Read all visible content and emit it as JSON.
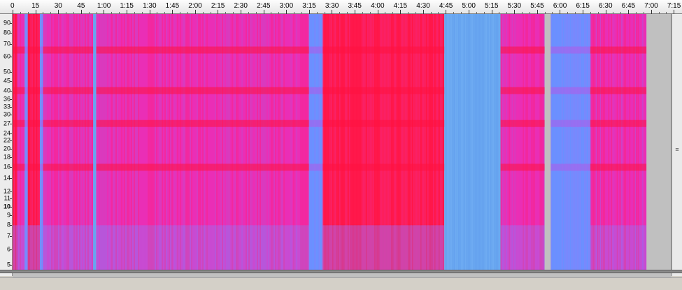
{
  "ruler": {
    "labels": [
      "0",
      "15",
      "30",
      "45",
      "1:00",
      "1:15",
      "1:30",
      "1:45",
      "2:00",
      "2:15",
      "2:30",
      "2:45",
      "3:00",
      "3:15",
      "3:30",
      "3:45",
      "4:00",
      "4:15",
      "4:30",
      "4:45",
      "5:00",
      "5:15",
      "5:30",
      "5:45",
      "6:00",
      "6:15",
      "6:30",
      "6:45",
      "7:00",
      "7:15"
    ],
    "seconds": [
      0,
      15,
      30,
      45,
      60,
      75,
      90,
      105,
      120,
      135,
      150,
      165,
      180,
      195,
      210,
      225,
      240,
      255,
      270,
      285,
      300,
      315,
      330,
      345,
      360,
      375,
      390,
      405,
      420,
      435
    ]
  },
  "frequency_axis": {
    "labels": [
      "90",
      "80",
      "70",
      "60",
      "50",
      "45",
      "40",
      "36",
      "33",
      "30",
      "27",
      "24",
      "22",
      "20",
      "18",
      "16",
      "14",
      "12",
      "11",
      "10",
      "9",
      "8",
      "7",
      "6",
      "5"
    ],
    "values": [
      90,
      80,
      70,
      60,
      50,
      45,
      40,
      36,
      33,
      30,
      27,
      24,
      22,
      20,
      18,
      16,
      14,
      12,
      11,
      10,
      9,
      8,
      7,
      6,
      5
    ],
    "emphasized": "10"
  },
  "spectrogram": {
    "total_seconds": 433,
    "audio_end_seconds": 417,
    "colors": {
      "hot": "#ff1a4d",
      "warm": "#ef2bb0",
      "cool": "#6f8dff",
      "cold": "#6aa8f0",
      "blank": "#c0c0c0"
    },
    "segments": [
      {
        "start": 0,
        "end": 3,
        "level": "hot"
      },
      {
        "start": 3,
        "end": 8,
        "level": "warm"
      },
      {
        "start": 8,
        "end": 10,
        "level": "cool"
      },
      {
        "start": 10,
        "end": 18,
        "level": "hot"
      },
      {
        "start": 18,
        "end": 20,
        "level": "cool"
      },
      {
        "start": 20,
        "end": 53,
        "level": "warm"
      },
      {
        "start": 53,
        "end": 55,
        "level": "cold"
      },
      {
        "start": 55,
        "end": 195,
        "level": "warm"
      },
      {
        "start": 195,
        "end": 204,
        "level": "cool"
      },
      {
        "start": 204,
        "end": 284,
        "level": "hot"
      },
      {
        "start": 284,
        "end": 321,
        "level": "cold"
      },
      {
        "start": 321,
        "end": 350,
        "level": "warm"
      },
      {
        "start": 350,
        "end": 354,
        "level": "blank"
      },
      {
        "start": 354,
        "end": 380,
        "level": "cool"
      },
      {
        "start": 380,
        "end": 417,
        "level": "warm"
      }
    ],
    "bands": [
      {
        "freq": 65,
        "level": "hot"
      },
      {
        "freq": 40,
        "level": "hot"
      },
      {
        "freq": 27,
        "level": "hot"
      },
      {
        "freq": 16,
        "level": "hot"
      }
    ]
  },
  "scrollbar": {
    "grip": "≡"
  }
}
